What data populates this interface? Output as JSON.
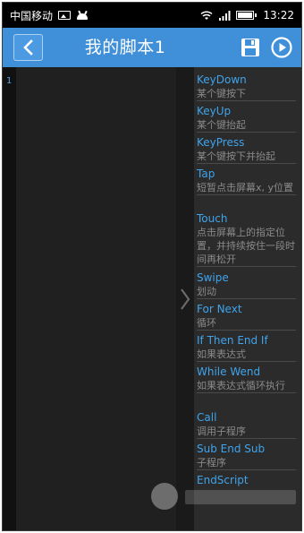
{
  "statusbar": {
    "carrier": "中国移动",
    "time": "13:22"
  },
  "titlebar": {
    "title": "我的脚本1"
  },
  "editor": {
    "line_number": "1"
  },
  "commands": [
    {
      "name": "KeyDown",
      "desc": "某个键按下"
    },
    {
      "name": "KeyUp",
      "desc": "某个键抬起"
    },
    {
      "name": "KeyPress",
      "desc": "某个键按下并抬起"
    },
    {
      "name": "Tap",
      "desc": "短暂点击屏幕x, y位置"
    },
    {
      "name": "Touch",
      "desc": "点击屏幕上的指定位置，并持续按住一段时间再松开"
    },
    {
      "name": "Swipe",
      "desc": "划动"
    },
    {
      "name": "For Next",
      "desc": "循环"
    },
    {
      "name": "If Then End If",
      "desc": "如果表达式"
    },
    {
      "name": "While Wend",
      "desc": "如果表达式循环执行"
    },
    {
      "name": "Call",
      "desc": "调用子程序"
    },
    {
      "name": "Sub End Sub",
      "desc": "子程序"
    },
    {
      "name": "EndScript",
      "desc": ""
    }
  ],
  "colors": {
    "accent": "#3f8fd9",
    "command_text": "#3fa4ec"
  }
}
